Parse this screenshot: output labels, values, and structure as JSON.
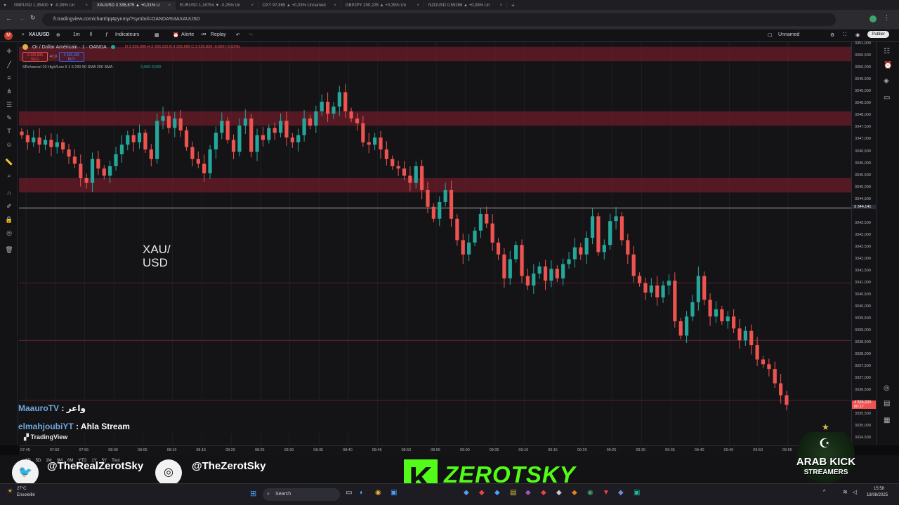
{
  "browser": {
    "tabs": [
      {
        "label": "GBPUSD 1,35400 ▼ -0,09% Un"
      },
      {
        "label": "XAUUSD 3 335,875 ▲ +0,01% U",
        "active": true
      },
      {
        "label": "EURUSD 1,16754 ▼ -0,25% Un"
      },
      {
        "label": "DXY 97,865 ▲ +0,03% Unnamed"
      },
      {
        "label": "GBPJPY 200,226 ▲ +0,39% Un"
      },
      {
        "label": "NZDUSD 0,59266 ▲ +0,08% Un"
      }
    ],
    "url": "fr.tradingview.com/chart/qq4pynmy/?symbol=OANDA%3AXAUUSD"
  },
  "toolbar": {
    "symbol": "XAUUSD",
    "interval": "1m",
    "indicators_label": "Indicateurs",
    "alert_label": "Alerte",
    "replay_label": "Replay",
    "layout_name": "Unnamed",
    "publish_label": "Publier"
  },
  "legend": {
    "title": "Or / Dollar Américain · 1 · OANDA",
    "ohlc": "O 3 336,000  H 3 336,315  B 3 335,690  C 3 335,920  -0,560 (-0,02%)",
    "sell_price": "3 335,695",
    "sell_label": "SELL",
    "spread": "47,0",
    "buy_price": "3 336,165",
    "buy_label": "BUY",
    "indicator": "SRchannel 10 High/Low 5 1 6 290 50 SMA 200 SMA",
    "indicator_values": "0,000  0,000"
  },
  "chart_label": {
    "line1": "XAU/",
    "line2": "USD"
  },
  "chart_data": {
    "type": "candlestick",
    "price_axis": [
      "3351,000",
      "3350,500",
      "3350,000",
      "3349,500",
      "3349,000",
      "3348,500",
      "3348,000",
      "3347,500",
      "3347,000",
      "3346,500",
      "3346,000",
      "3345,500",
      "3345,000",
      "3344,500",
      "3343,500",
      "3343,000",
      "3342,500",
      "3342,000",
      "3341,500",
      "3341,000",
      "3340,500",
      "3340,000",
      "3339,500",
      "3339,000",
      "3338,500",
      "3338,000",
      "3337,500",
      "3337,000",
      "3336,500",
      "3336,000",
      "3335,500",
      "3335,000",
      "3334,500"
    ],
    "time_axis": [
      "07:45",
      "07:50",
      "07:55",
      "08:00",
      "08:05",
      "08:10",
      "08:15",
      "08:20",
      "08:25",
      "08:30",
      "08:35",
      "08:40",
      "08:45",
      "08:50",
      "08:55",
      "09:00",
      "09:05",
      "09:10",
      "09:15",
      "09:20",
      "09:25",
      "09:30",
      "09:35",
      "09:40",
      "09:45",
      "09:50",
      "09:55"
    ],
    "ylim": [
      3334.2,
      3351.1
    ],
    "current_price": "3 335,920",
    "current_countdown": "00:17",
    "crosshair_price": "3 344,141",
    "crosshair_value": 3344.141,
    "closes": [
      3347.2,
      3346.9,
      3347.1,
      3346.8,
      3347.0,
      3346.7,
      3346.9,
      3346.6,
      3346.3,
      3346.0,
      3345.4,
      3345.2,
      3346.2,
      3345.8,
      3345.5,
      3345.9,
      3346.4,
      3346.8,
      3347.2,
      3346.9,
      3347.3,
      3346.6,
      3346.2,
      3347.8,
      3348.0,
      3347.5,
      3347.9,
      3347.4,
      3346.7,
      3346.2,
      3346.0,
      3345.6,
      3346.6,
      3347.3,
      3347.8,
      3347.0,
      3346.5,
      3347.6,
      3347.9,
      3346.5,
      3347.2,
      3347.0,
      3347.5,
      3347.3,
      3347.8,
      3347.1,
      3346.9,
      3347.2,
      3347.9,
      3347.6,
      3348.2,
      3348.6,
      3348.1,
      3348.4,
      3349.0,
      3348.2,
      3347.9,
      3347.7,
      3346.9,
      3346.8,
      3347.1,
      3346.6,
      3346.2,
      3345.9,
      3345.8,
      3345.5,
      3345.2,
      3345.9,
      3344.9,
      3344.2,
      3343.7,
      3344.4,
      3344.9,
      3343.7,
      3342.8,
      3342.2,
      3342.7,
      3343.2,
      3343.9,
      3343.5,
      3342.7,
      3342.2,
      3341.2,
      3342.0,
      3342.6,
      3341.3,
      3340.9,
      3341.4,
      3341.7,
      3341.1,
      3341.6,
      3341.2,
      3341.8,
      3342.0,
      3342.5,
      3342.2,
      3342.9,
      3343.8,
      3342.3,
      3342.6,
      3343.6,
      3343.8,
      3342.8,
      3342.2,
      3341.3,
      3341.0,
      3340.6,
      3340.9,
      3340.4,
      3340.9,
      3341.1,
      3339.4,
      3338.8,
      3339.6,
      3340.2,
      3341.3,
      3340.3,
      3339.6,
      3339.9,
      3339.4,
      3339.6,
      3339.1,
      3338.6,
      3339.0,
      3338.4,
      3337.8,
      3337.6,
      3337.4,
      3336.8,
      3336.3,
      3335.9
    ]
  },
  "zones": [
    {
      "top": 3350.9,
      "bottom": 3350.3
    },
    {
      "top": 3348.2,
      "bottom": 3347.6
    },
    {
      "top": 3345.4,
      "bottom": 3344.8
    }
  ],
  "hlines": [
    3341.0,
    3338.6,
    3336.1
  ],
  "chat": [
    {
      "user": "MaauroTV",
      "message": "واعر"
    },
    {
      "user": "elmahjoubiYT",
      "message": "Ahla Stream"
    }
  ],
  "tv_logo": "TradingView",
  "ranges": [
    "1D",
    "5D",
    "1M",
    "3M",
    "6M",
    "YTD",
    "1Y",
    "5Y",
    "Tout"
  ],
  "overlay": {
    "twitter_handle": "@TheRealZerotSky",
    "instagram_handle": "@TheZerotSky",
    "brand_letter": "K",
    "brand_name": "ZEROTSKY",
    "badge_line1": "ARAB KICK",
    "badge_line2": "STREAMERS"
  },
  "taskbar": {
    "search": "Search",
    "weather_temp": "27°C",
    "weather_desc": "Ensoleillé",
    "time": "15:58",
    "date": "18/08/2025"
  },
  "colors": {
    "up": "#26a69a",
    "down": "#ef5350",
    "zone": "#8b1e2e",
    "kick_green": "#53fc18"
  }
}
